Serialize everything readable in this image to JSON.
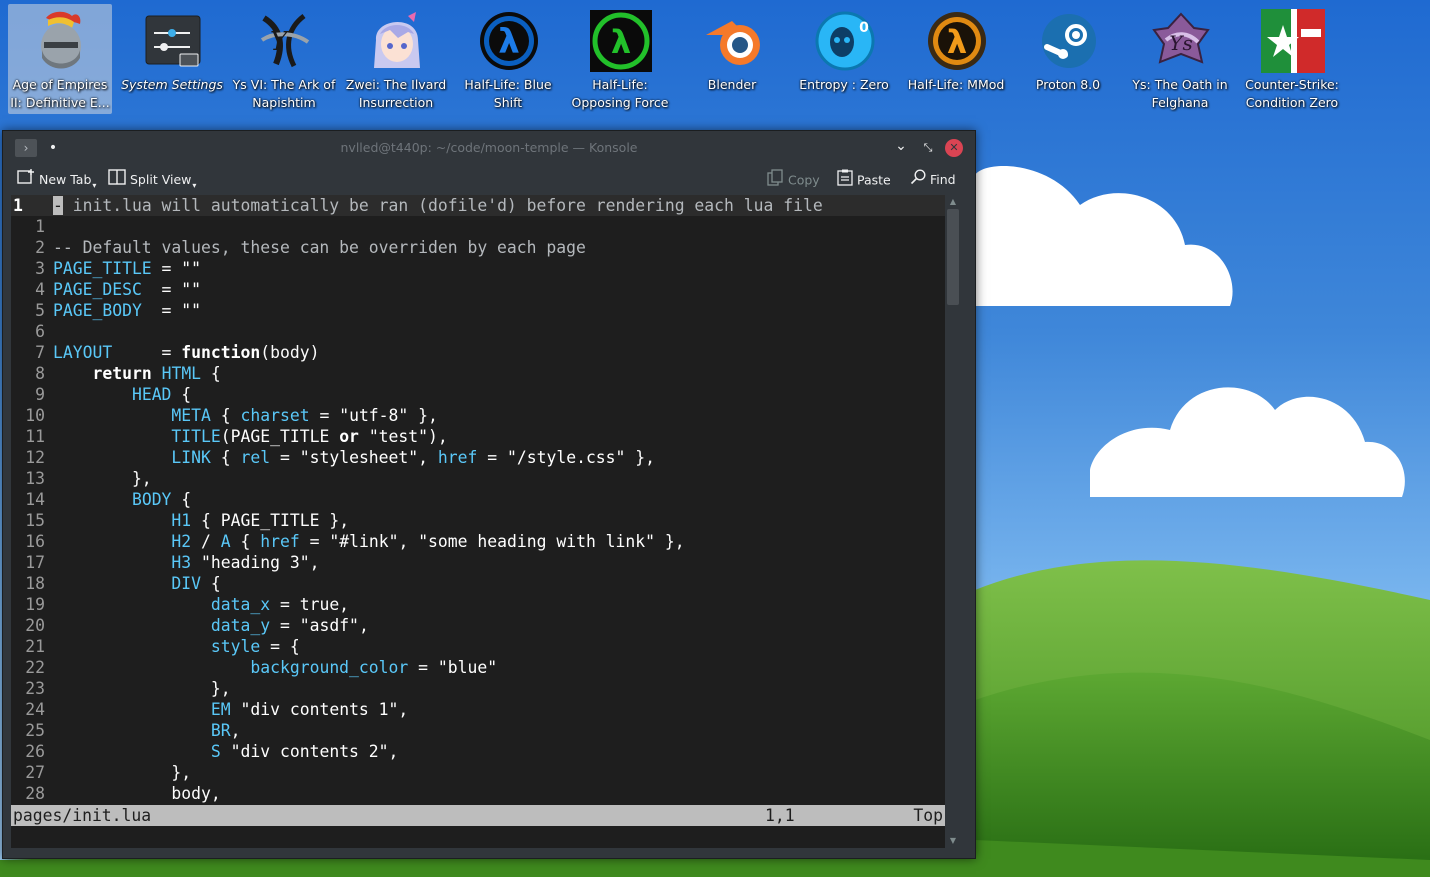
{
  "desktop": {
    "icons": [
      {
        "label": "Age of Empires\nII: Definitive E...",
        "icon": "helmet-icon",
        "selected": true
      },
      {
        "label": "System Settings",
        "icon": "settings-icon"
      },
      {
        "label": "Ys VI: The Ark of\nNapishtim",
        "icon": "ys-icon"
      },
      {
        "label": "Zwei: The Ilvard\nInsurrection",
        "icon": "anime-girl-icon"
      },
      {
        "label": "Half-Life: Blue\nShift",
        "icon": "lambda-blue-icon"
      },
      {
        "label": "Half-Life:\nOpposing Force",
        "icon": "lambda-green-icon"
      },
      {
        "label": "Blender",
        "icon": "blender-icon"
      },
      {
        "label": "Entropy : Zero",
        "icon": "entropy-icon"
      },
      {
        "label": "Half-Life: MMod",
        "icon": "lambda-orange-icon"
      },
      {
        "label": "Proton 8.0",
        "icon": "steam-icon"
      },
      {
        "label": "Ys: The Oath in\nFelghana",
        "icon": "ys-oath-icon"
      },
      {
        "label": "Counter-Strike:\nCondition Zero",
        "icon": "cs-icon"
      }
    ]
  },
  "window": {
    "title": "nvlled@t440p: ~/code/moon-temple — Konsole",
    "pin_glyph": "•",
    "minimize_glyph": "⌄",
    "maximize_glyph": "⤡",
    "close_glyph": "✕"
  },
  "toolbar": {
    "new_tab": "New Tab",
    "split_view": "Split View",
    "copy": "Copy",
    "paste": "Paste",
    "find": "Find"
  },
  "editor": {
    "current_line": {
      "number": "1",
      "cursor_char": "-",
      "text": "- init.lua will automatically be ran (dofile'd) before rendering each lua file"
    },
    "lines": [
      {
        "n": "1",
        "segs": []
      },
      {
        "n": "2",
        "segs": [
          {
            "c": "comment",
            "t": "-- Default values, these can be overriden by each page"
          }
        ]
      },
      {
        "n": "3",
        "segs": [
          {
            "c": "ident",
            "t": "PAGE_TITLE"
          },
          {
            "c": "plain",
            "t": " = "
          },
          {
            "c": "str",
            "t": "\"\""
          }
        ]
      },
      {
        "n": "4",
        "segs": [
          {
            "c": "ident",
            "t": "PAGE_DESC"
          },
          {
            "c": "plain",
            "t": "  = "
          },
          {
            "c": "str",
            "t": "\"\""
          }
        ]
      },
      {
        "n": "5",
        "segs": [
          {
            "c": "ident",
            "t": "PAGE_BODY"
          },
          {
            "c": "plain",
            "t": "  = "
          },
          {
            "c": "str",
            "t": "\"\""
          }
        ]
      },
      {
        "n": "6",
        "segs": []
      },
      {
        "n": "7",
        "segs": [
          {
            "c": "ident",
            "t": "LAYOUT"
          },
          {
            "c": "plain",
            "t": "     = "
          },
          {
            "c": "kw",
            "t": "function"
          },
          {
            "c": "plain",
            "t": "(body)"
          }
        ]
      },
      {
        "n": "8",
        "segs": [
          {
            "c": "plain",
            "t": "    "
          },
          {
            "c": "kw",
            "t": "return"
          },
          {
            "c": "plain",
            "t": " "
          },
          {
            "c": "ident",
            "t": "HTML"
          },
          {
            "c": "plain",
            "t": " {"
          }
        ]
      },
      {
        "n": "9",
        "segs": [
          {
            "c": "plain",
            "t": "        "
          },
          {
            "c": "ident",
            "t": "HEAD"
          },
          {
            "c": "plain",
            "t": " {"
          }
        ]
      },
      {
        "n": "10",
        "segs": [
          {
            "c": "plain",
            "t": "            "
          },
          {
            "c": "ident",
            "t": "META"
          },
          {
            "c": "plain",
            "t": " { "
          },
          {
            "c": "ident",
            "t": "charset"
          },
          {
            "c": "plain",
            "t": " = "
          },
          {
            "c": "str",
            "t": "\"utf-8\""
          },
          {
            "c": "plain",
            "t": " },"
          }
        ]
      },
      {
        "n": "11",
        "segs": [
          {
            "c": "plain",
            "t": "            "
          },
          {
            "c": "ident",
            "t": "TITLE"
          },
          {
            "c": "plain",
            "t": "(PAGE_TITLE "
          },
          {
            "c": "kw",
            "t": "or"
          },
          {
            "c": "plain",
            "t": " "
          },
          {
            "c": "str",
            "t": "\"test\""
          },
          {
            "c": "plain",
            "t": "),"
          }
        ]
      },
      {
        "n": "12",
        "segs": [
          {
            "c": "plain",
            "t": "            "
          },
          {
            "c": "ident",
            "t": "LINK"
          },
          {
            "c": "plain",
            "t": " { "
          },
          {
            "c": "ident",
            "t": "rel"
          },
          {
            "c": "plain",
            "t": " = "
          },
          {
            "c": "str",
            "t": "\"stylesheet\""
          },
          {
            "c": "plain",
            "t": ", "
          },
          {
            "c": "ident",
            "t": "href"
          },
          {
            "c": "plain",
            "t": " = "
          },
          {
            "c": "str",
            "t": "\"/style.css\""
          },
          {
            "c": "plain",
            "t": " },"
          }
        ]
      },
      {
        "n": "13",
        "segs": [
          {
            "c": "plain",
            "t": "        },"
          }
        ]
      },
      {
        "n": "14",
        "segs": [
          {
            "c": "plain",
            "t": "        "
          },
          {
            "c": "ident",
            "t": "BODY"
          },
          {
            "c": "plain",
            "t": " {"
          }
        ]
      },
      {
        "n": "15",
        "segs": [
          {
            "c": "plain",
            "t": "            "
          },
          {
            "c": "ident",
            "t": "H1"
          },
          {
            "c": "plain",
            "t": " { PAGE_TITLE },"
          }
        ]
      },
      {
        "n": "16",
        "segs": [
          {
            "c": "plain",
            "t": "            "
          },
          {
            "c": "ident",
            "t": "H2"
          },
          {
            "c": "plain",
            "t": " / "
          },
          {
            "c": "ident",
            "t": "A"
          },
          {
            "c": "plain",
            "t": " { "
          },
          {
            "c": "ident",
            "t": "href"
          },
          {
            "c": "plain",
            "t": " = "
          },
          {
            "c": "str",
            "t": "\"#link\""
          },
          {
            "c": "plain",
            "t": ", "
          },
          {
            "c": "str",
            "t": "\"some heading with link\""
          },
          {
            "c": "plain",
            "t": " },"
          }
        ]
      },
      {
        "n": "17",
        "segs": [
          {
            "c": "plain",
            "t": "            "
          },
          {
            "c": "ident",
            "t": "H3"
          },
          {
            "c": "plain",
            "t": " "
          },
          {
            "c": "str",
            "t": "\"heading 3\""
          },
          {
            "c": "plain",
            "t": ","
          }
        ]
      },
      {
        "n": "18",
        "segs": [
          {
            "c": "plain",
            "t": "            "
          },
          {
            "c": "ident",
            "t": "DIV"
          },
          {
            "c": "plain",
            "t": " {"
          }
        ]
      },
      {
        "n": "19",
        "segs": [
          {
            "c": "plain",
            "t": "                "
          },
          {
            "c": "ident",
            "t": "data_x"
          },
          {
            "c": "plain",
            "t": " = true,"
          }
        ]
      },
      {
        "n": "20",
        "segs": [
          {
            "c": "plain",
            "t": "                "
          },
          {
            "c": "ident",
            "t": "data_y"
          },
          {
            "c": "plain",
            "t": " = "
          },
          {
            "c": "str",
            "t": "\"asdf\""
          },
          {
            "c": "plain",
            "t": ","
          }
        ]
      },
      {
        "n": "21",
        "segs": [
          {
            "c": "plain",
            "t": "                "
          },
          {
            "c": "ident",
            "t": "style"
          },
          {
            "c": "plain",
            "t": " = {"
          }
        ]
      },
      {
        "n": "22",
        "segs": [
          {
            "c": "plain",
            "t": "                    "
          },
          {
            "c": "ident",
            "t": "background_color"
          },
          {
            "c": "plain",
            "t": " = "
          },
          {
            "c": "str",
            "t": "\"blue\""
          }
        ]
      },
      {
        "n": "23",
        "segs": [
          {
            "c": "plain",
            "t": "                },"
          }
        ]
      },
      {
        "n": "24",
        "segs": [
          {
            "c": "plain",
            "t": "                "
          },
          {
            "c": "ident",
            "t": "EM"
          },
          {
            "c": "plain",
            "t": " "
          },
          {
            "c": "str",
            "t": "\"div contents 1\""
          },
          {
            "c": "plain",
            "t": ","
          }
        ]
      },
      {
        "n": "25",
        "segs": [
          {
            "c": "plain",
            "t": "                "
          },
          {
            "c": "ident",
            "t": "BR"
          },
          {
            "c": "plain",
            "t": ","
          }
        ]
      },
      {
        "n": "26",
        "segs": [
          {
            "c": "plain",
            "t": "                "
          },
          {
            "c": "ident",
            "t": "S"
          },
          {
            "c": "plain",
            "t": " "
          },
          {
            "c": "str",
            "t": "\"div contents 2\""
          },
          {
            "c": "plain",
            "t": ","
          }
        ]
      },
      {
        "n": "27",
        "segs": [
          {
            "c": "plain",
            "t": "            },"
          }
        ]
      },
      {
        "n": "28",
        "segs": [
          {
            "c": "plain",
            "t": "            body,"
          }
        ]
      }
    ],
    "status": {
      "file": "pages/init.lua",
      "position": "1,1",
      "scroll": "Top"
    }
  },
  "colors": {
    "terminal_bg": "#1e1e1e",
    "identifier": "#5ac8f8",
    "statusline_bg": "#bdbdbd",
    "close_button": "#da4453",
    "window_chrome": "#31363b"
  }
}
